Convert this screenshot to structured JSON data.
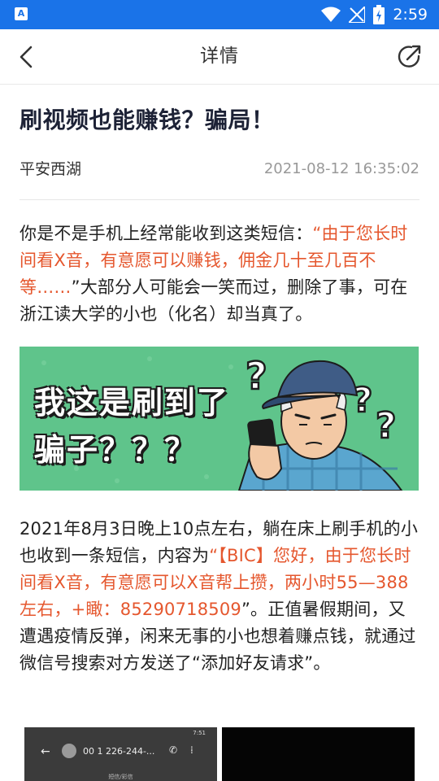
{
  "status_bar": {
    "time": "2:59",
    "app_icon_label": "A",
    "icons": [
      "wifi-icon",
      "signal-icon",
      "battery-icon"
    ]
  },
  "header": {
    "title": "详情",
    "back_icon": "chevron-left-icon",
    "share_icon": "share-icon"
  },
  "article": {
    "title": "刷视频也能赚钱？骗局！",
    "source": "平安西湖",
    "date": "2021-08-12 16:35:02",
    "p1_normal_1": "你是不是手机上经常能收到这类短信：",
    "p1_highlight": "“由于您长时间看X音，有意愿可以赚钱，佣金几十至几百不等……",
    "p1_normal_2": "”大部分人可能会一笑而过，删除了事，可在浙江读大学的小也（化名）却当真了。",
    "banner_line1": "我这是刷到了",
    "banner_line2": "骗子？？？",
    "p2_normal_1": "2021年8月3日晚上10点左右，躺在床上刷手机的小也收到一条短信，内容为",
    "p2_highlight": "“【BIC】您好，由于您长时间看X音，有意愿可以X音帮上攒，两小时55—388左右，+瞰：85290718509",
    "p2_normal_2": "”。正值暑假期间，又遭遇疫情反弹，闲来无事的小也想着赚点钱，就通过微信号搜索对方发送了“添加好友请求”。",
    "thumb1_number": "00 1 226-244-...",
    "thumb1_time": "7:51",
    "thumb1_sub": "短信/彩信"
  },
  "colors": {
    "status_bar": "#1a73e8",
    "highlight": "#e5572e",
    "title": "#1d2236",
    "banner_bg": "#5fc48b"
  }
}
